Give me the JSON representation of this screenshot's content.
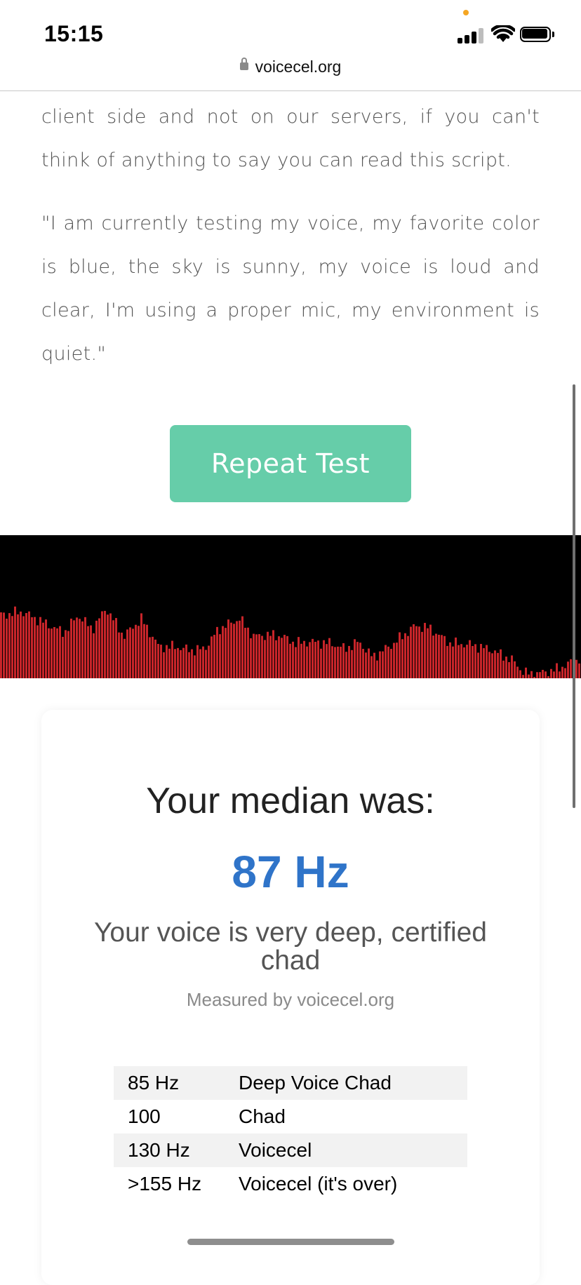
{
  "status_bar": {
    "time": "15:15"
  },
  "browser": {
    "url": "voicecel.org"
  },
  "content": {
    "paragraph_intro": "client side and not on our servers, if you can't think of anything to say you can read this script.",
    "paragraph_script": "\"I am currently testing my voice, my favorite color is blue, the sky is sunny, my voice is loud and clear, I'm using a proper mic, my environment is quiet.\"",
    "repeat_button_label": "Repeat Test"
  },
  "results": {
    "median_label": "Your median was:",
    "median_value": "87 Hz",
    "verdict": "Your voice is very deep, certified chad",
    "measured_by": "Measured by voicecel.org",
    "accent_color": "#2f74c9"
  },
  "pitch_table": {
    "rows": [
      {
        "freq": "85 Hz",
        "label": "Deep Voice Chad"
      },
      {
        "freq": "100",
        "label": "Chad"
      },
      {
        "freq": "130 Hz",
        "label": "Voicecel"
      },
      {
        "freq": ">155 Hz",
        "label": "Voicecel (it's over)"
      }
    ]
  },
  "visualizer": {
    "bar_color": "#c8252a",
    "background": "#000000"
  },
  "colors": {
    "button": "#66cda9"
  }
}
